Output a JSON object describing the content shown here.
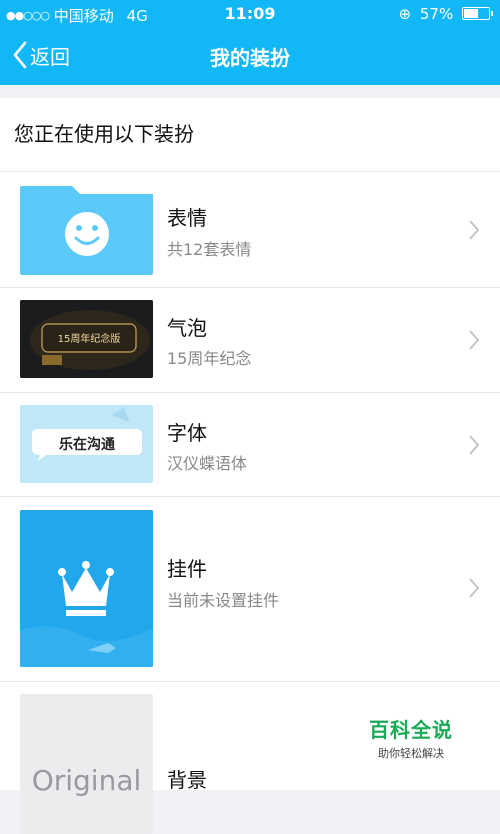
{
  "status": {
    "carrier": "中国移动",
    "network": "4G",
    "time": "11:09",
    "battery": "57%",
    "battery_level": 0.57
  },
  "nav": {
    "back_label": "返回",
    "title": "我的装扮"
  },
  "section_title": "您正在使用以下装扮",
  "items": [
    {
      "name": "表情",
      "desc": "共12套表情",
      "thumb_icon": "smiley-folder-icon"
    },
    {
      "name": "气泡",
      "desc": "15周年纪念",
      "thumb_text": "15周年纪念版"
    },
    {
      "name": "字体",
      "desc": "汉仪蝶语体",
      "thumb_text": "乐在沟通"
    },
    {
      "name": "挂件",
      "desc": "当前未设置挂件",
      "thumb_icon": "crown-icon"
    },
    {
      "name": "背景",
      "desc": "",
      "thumb_text": "Original"
    }
  ],
  "watermark": {
    "title": "百科全说",
    "subtitle": "助你轻松解决"
  },
  "colors": {
    "header": "#12b7f5",
    "watermark": "#1aaa55"
  }
}
